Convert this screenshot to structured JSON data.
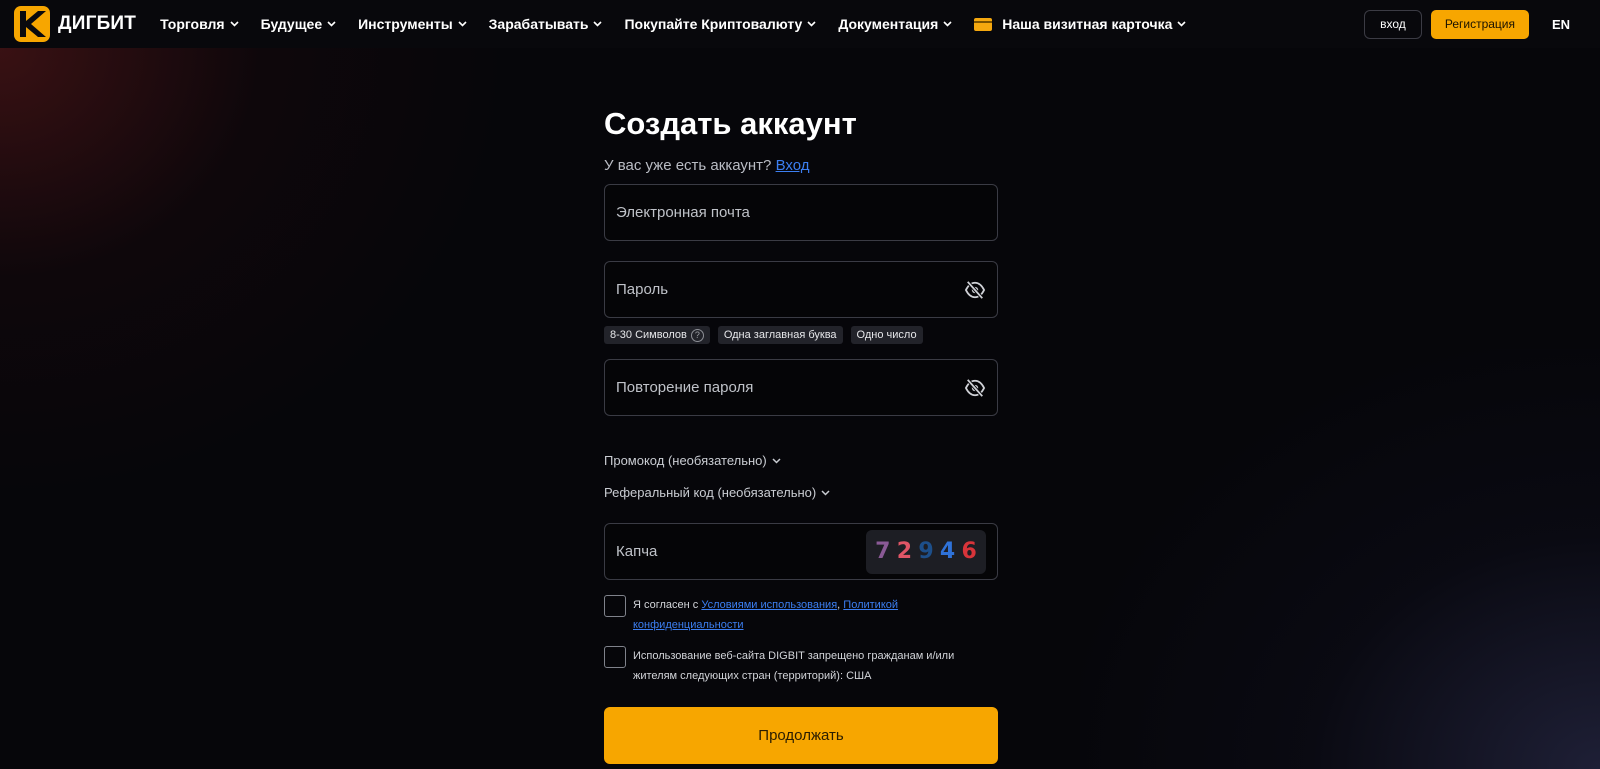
{
  "brand": {
    "name": "ДИГБИТ",
    "logo": "digbit-logo-icon",
    "accent": "#f7a600"
  },
  "nav": {
    "items": [
      {
        "label": "Торговля"
      },
      {
        "label": "Будущее"
      },
      {
        "label": "Инструменты"
      },
      {
        "label": "Зарабатывать"
      },
      {
        "label": "Покупайте Криптовалюту"
      },
      {
        "label": "Документация"
      },
      {
        "label": "Наша визитная карточка",
        "icon": "card-icon"
      }
    ]
  },
  "header": {
    "login_label": "вход",
    "register_label": "Регистрация",
    "language": "EN"
  },
  "form": {
    "title": "Создать аккаунт",
    "has_account_text": "У вас уже есть аккаунт?",
    "login_link": "Вход",
    "email": {
      "placeholder": "Электронная почта",
      "value": ""
    },
    "password": {
      "placeholder": "Пароль",
      "value": ""
    },
    "requirements": [
      "8-30 Символов",
      "Одна заглавная буква",
      "Одно число"
    ],
    "requirements_help": "?",
    "confirm_password": {
      "placeholder": "Повторение пароля",
      "value": ""
    },
    "promo_toggle": "Промокод (необязательно)",
    "referral_toggle": "Реферальный код (необязательно)",
    "captcha": {
      "placeholder": "Капча",
      "value": "",
      "digits": [
        {
          "char": "7",
          "color": "#8a5a96"
        },
        {
          "char": "2",
          "color": "#e05566"
        },
        {
          "char": "9",
          "color": "#1d4f8a"
        },
        {
          "char": "4",
          "color": "#2f72d8"
        },
        {
          "char": "6",
          "color": "#d8343a"
        }
      ]
    },
    "terms": {
      "prefix": "Я согласен с",
      "terms_link": "Условиями использования",
      "separator": ",",
      "privacy_link": "Политикой конфиденциальности"
    },
    "restriction_text": "Использование веб-сайта DIGBIT запрещено гражданам и/или жителям следующих стран (территорий): США",
    "continue_label": "Продолжать"
  }
}
